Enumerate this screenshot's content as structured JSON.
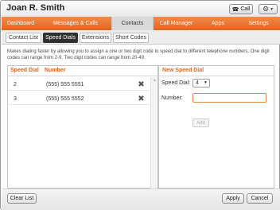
{
  "header": {
    "title": "Joan R. Smith",
    "call_label": "Call",
    "call_icon": "phone-icon",
    "settings_icon": "gear-icon"
  },
  "nav": {
    "items": [
      {
        "label": "Dashboard"
      },
      {
        "label": "Messages & Calls"
      },
      {
        "label": "Contacts"
      },
      {
        "label": "Call Manager"
      },
      {
        "label": "Apps"
      },
      {
        "label": "Settings"
      }
    ],
    "active": "Contacts"
  },
  "subtabs": {
    "items": [
      {
        "label": "Contact List"
      },
      {
        "label": "Speed Dials"
      },
      {
        "label": "Extensions"
      },
      {
        "label": "Short Codes"
      }
    ],
    "active": "Speed Dials"
  },
  "description": "Makes dialing faster by allowing you to assign a one or two digit code to speed dial to different telephone numbers. One digit codes can range from 2-9. Two digit codes can range from 20-49.",
  "speed_dials": {
    "col_speed_dial": "Speed Dial",
    "col_number": "Number",
    "rows": [
      {
        "code": "2",
        "number": "(555) 555 5551"
      },
      {
        "code": "3",
        "number": "(555) 555 5552"
      }
    ]
  },
  "new_speed_dial": {
    "title": "New Speed Dial",
    "speed_dial_label": "Speed Dial:",
    "speed_dial_value": "4",
    "number_label": "Number:",
    "number_value": "",
    "add_label": "Add"
  },
  "footer": {
    "clear_label": "Clear List",
    "apply_label": "Apply",
    "cancel_label": "Cancel"
  },
  "colors": {
    "accent": "#e2651f",
    "nav_active_bg": "#d9d9d9",
    "subtab_active_bg": "#2f2f2f"
  }
}
